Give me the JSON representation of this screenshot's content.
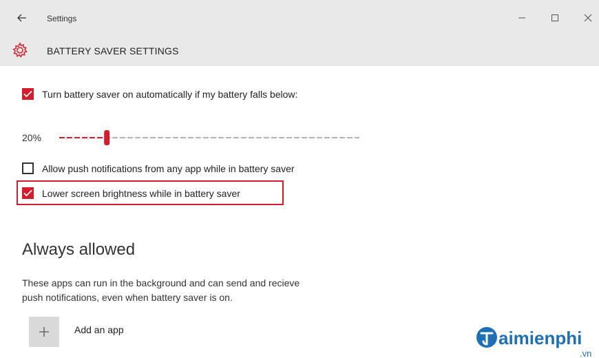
{
  "window": {
    "title": "Settings",
    "back_icon": "back-arrow-icon",
    "controls": [
      "minimize-icon",
      "maximize-icon",
      "close-icon"
    ]
  },
  "header": {
    "icon": "gear-icon",
    "title": "BATTERY SAVER SETTINGS"
  },
  "settings": {
    "auto_on": {
      "label": "Turn battery saver on automatically if my battery falls below:",
      "checked": true
    },
    "threshold": {
      "display": "20%",
      "value_percent": 20
    },
    "push_notifications": {
      "label": "Allow push notifications from any app while in battery saver",
      "checked": false
    },
    "lower_brightness": {
      "label": "Lower screen brightness while in battery saver",
      "checked": true,
      "highlighted": true
    }
  },
  "always_allowed": {
    "title": "Always allowed",
    "description_line1": "These apps can run in the background and can send and recieve",
    "description_line2": "push notifications, even when battery saver is on.",
    "add_app_label": "Add an app",
    "add_icon": "plus-icon"
  },
  "watermark": {
    "text": "aimienphi",
    "suffix": ".vn"
  },
  "colors": {
    "accent": "#d41c2c",
    "header_bg": "#e9e9e9",
    "tile_bg": "#d9d9d9"
  }
}
